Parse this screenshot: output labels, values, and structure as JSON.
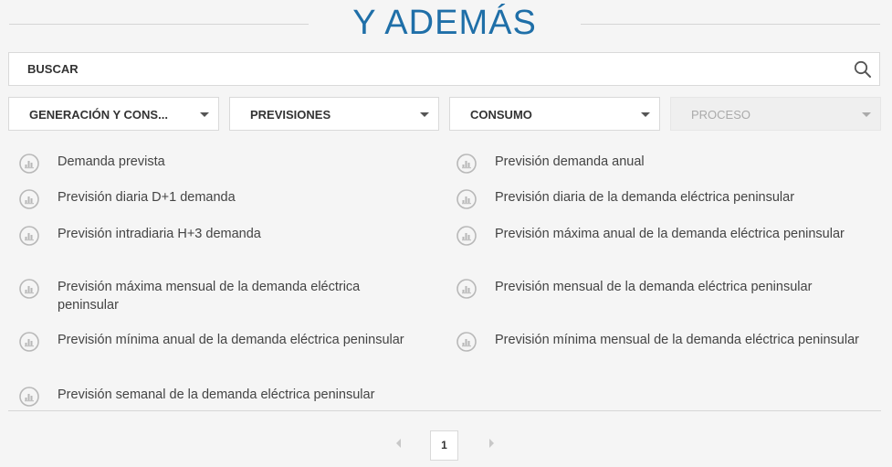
{
  "header": {
    "title": "Y ADEMÁS"
  },
  "search": {
    "placeholder": "BUSCAR",
    "value": ""
  },
  "filters": [
    {
      "label": "GENERACIÓN Y CONS...",
      "enabled": true
    },
    {
      "label": "PREVISIONES",
      "enabled": true
    },
    {
      "label": "CONSUMO",
      "enabled": true
    },
    {
      "label": "PROCESO",
      "enabled": false
    }
  ],
  "results": {
    "icon": "chart-icon",
    "items": [
      "Demanda prevista",
      "Previsión demanda anual",
      "Previsión diaria D+1 demanda",
      "Previsión diaria de la demanda eléctrica peninsular",
      "Previsión intradiaria H+3 demanda",
      "Previsión máxima anual de la demanda eléctrica peninsular",
      "Previsión máxima mensual de la demanda eléctrica peninsular",
      "Previsión mensual de la demanda eléctrica peninsular",
      "Previsión mínima anual de la demanda eléctrica peninsular",
      "Previsión mínima mensual de la demanda eléctrica peninsular",
      "Previsión semanal de la demanda eléctrica peninsular"
    ]
  },
  "pagination": {
    "current_page": "1"
  },
  "colors": {
    "title": "#1f6fa8",
    "background": "#f5f5f5"
  }
}
